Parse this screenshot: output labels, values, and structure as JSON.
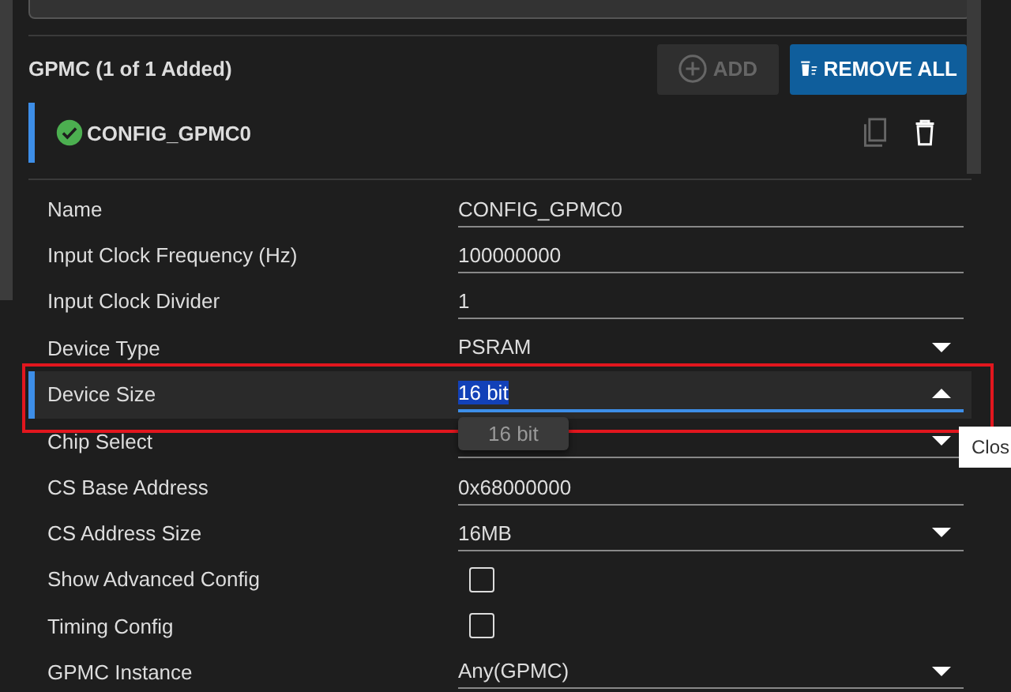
{
  "section": {
    "title": "GPMC (1 of 1 Added)",
    "add_button": {
      "label": "ADD",
      "disabled": true
    },
    "remove_all_button": {
      "label": "REMOVE ALL",
      "disabled": false
    }
  },
  "instance": {
    "name": "CONFIG_GPMC0",
    "valid": true
  },
  "fields": [
    {
      "kind": "text",
      "label": "Name",
      "value": "CONFIG_GPMC0"
    },
    {
      "kind": "text",
      "label": "Input Clock Frequency (Hz)",
      "value": "100000000"
    },
    {
      "kind": "text",
      "label": "Input Clock Divider",
      "value": "1"
    },
    {
      "kind": "select",
      "label": "Device Type",
      "value": "PSRAM",
      "open": false
    },
    {
      "kind": "select",
      "label": "Device Size",
      "value": "16 bit",
      "open": true,
      "highlighted": true
    },
    {
      "kind": "select",
      "label": "Chip Select",
      "open": false
    },
    {
      "kind": "text",
      "label": "CS Base Address",
      "value": "0x68000000"
    },
    {
      "kind": "select",
      "label": "CS Address Size",
      "value": "16MB",
      "open": false
    },
    {
      "kind": "checkbox",
      "label": "Show Advanced Config",
      "checked": false
    },
    {
      "kind": "checkbox",
      "label": "Timing Config",
      "checked": false
    },
    {
      "kind": "select",
      "label": "GPMC Instance",
      "value": "Any(GPMC)",
      "open": false
    }
  ],
  "dropdown_options": [
    "16 bit"
  ],
  "tooltip": "Clos"
}
